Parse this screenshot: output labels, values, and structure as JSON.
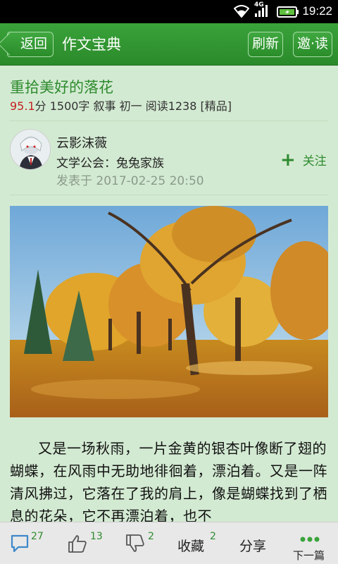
{
  "status": {
    "time": "19:22",
    "network": "4G"
  },
  "header": {
    "back": "返回",
    "title": "作文宝典",
    "refresh": "刷新",
    "invite": "邀·读"
  },
  "article": {
    "title": "重拾美好的落花",
    "score": "95.1",
    "meta_rest": "分 1500字 叙事 初一 阅读1238 [精品]",
    "author": "云影沫薇",
    "guild": "文学公会：兔兔家族",
    "posted": "发表于 2017-02-25 20:50",
    "follow": "关注",
    "body": "又是一场秋雨，一片金黄的银杏叶像断了翅的蝴蝶，在风雨中无助地徘徊着，漂泊着。又是一阵清风拂过，它落在了我的肩上，像是蝴蝶找到了栖息的花朵，它不再漂泊着，也不"
  },
  "bottombar": {
    "comments": "27",
    "likes": "13",
    "dislikes": "2",
    "favorite_label": "收藏",
    "favorites": "2",
    "share": "分享",
    "next": "下一篇"
  },
  "colors": {
    "accent": "#2e8b2e",
    "header": "#339933",
    "background": "#d3ead2",
    "score": "#c22222"
  }
}
